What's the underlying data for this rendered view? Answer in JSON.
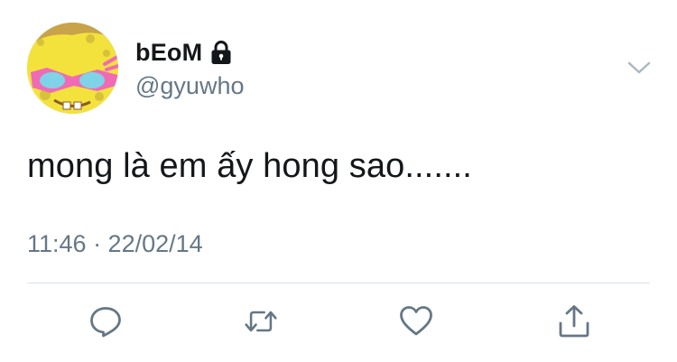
{
  "tweet": {
    "display_name": "bEoM",
    "handle": "@gyuwho",
    "text": "mong là em ấy hong sao.......",
    "timestamp": "11:46 · 22/02/14",
    "protected": true
  },
  "icons": {
    "lock": "lock-icon",
    "more": "chevron-down-icon",
    "reply": "reply-icon",
    "retweet": "retweet-icon",
    "like": "heart-icon",
    "share": "share-icon"
  },
  "colors": {
    "text_primary": "#14171a",
    "text_secondary": "#657786",
    "divider": "#dde3e8",
    "avatar_background": "#f4e23c",
    "glasses": "#f06ab5"
  }
}
